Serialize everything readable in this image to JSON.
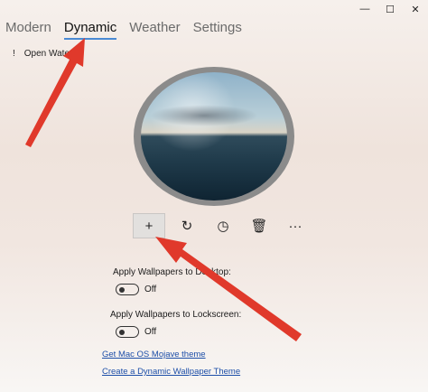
{
  "window": {
    "minimize_glyph": "—",
    "maximize_glyph": "☐",
    "close_glyph": "✕"
  },
  "tabs": [
    {
      "label": "Modern",
      "active": false
    },
    {
      "label": "Dynamic",
      "active": true
    },
    {
      "label": "Weather",
      "active": false
    },
    {
      "label": "Settings",
      "active": false
    }
  ],
  "notice": {
    "icon_text": "!",
    "text": "Open Wate"
  },
  "preview": {
    "description_icon": "wallpaper-preview"
  },
  "toolbar": {
    "add": "+",
    "refresh": "↻",
    "schedule": "◷",
    "delete": "🗑",
    "more": "···"
  },
  "settings": {
    "desktop_label": "Apply Wallpapers to Desktop:",
    "desktop_state": "Off",
    "lockscreen_label": "Apply Wallpapers to Lockscreen:",
    "lockscreen_state": "Off"
  },
  "links": {
    "mojave": "Get Mac OS Mojave theme",
    "create": "Create a Dynamic Wallpaper Theme"
  },
  "colors": {
    "accent": "#4a8ad4",
    "arrow": "#e0392b",
    "link": "#1d4fa8"
  }
}
